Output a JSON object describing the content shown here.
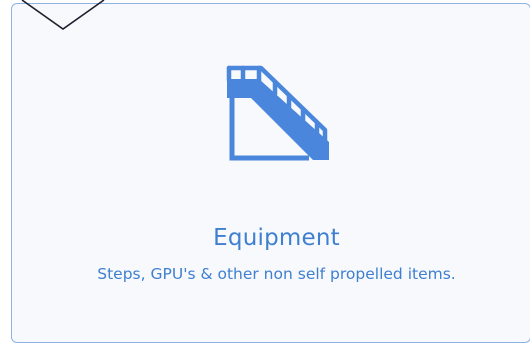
{
  "card": {
    "title": "Equipment",
    "description": "Steps, GPU's & other non self propelled items."
  },
  "icons": {
    "card_icon": "stair-truck-icon",
    "corner_icon": "chevron-down-icon"
  },
  "colors": {
    "accent": "#3f7fd0",
    "icon": "#4a86dc",
    "border": "#8fb2e3",
    "card_bg": "#f7f9fc"
  }
}
